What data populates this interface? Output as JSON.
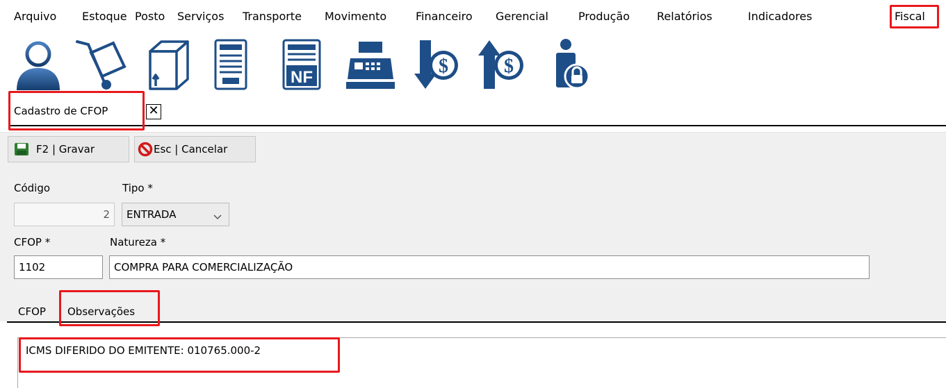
{
  "menu": {
    "items": [
      "Arquivo",
      "Estoque",
      "Posto",
      "Serviços",
      "Transporte",
      "Movimento",
      "Financeiro",
      "Gerencial",
      "Produção",
      "Relatórios",
      "Indicadores",
      "Fiscal"
    ]
  },
  "toolbar": {
    "icons": [
      "user-icon",
      "hand-truck-icon",
      "box-icon",
      "document-icon",
      "nf-invoice-icon",
      "cash-register-icon",
      "dollar-down-icon",
      "dollar-up-icon",
      "person-lock-icon"
    ],
    "nf_text": "NF"
  },
  "document_tab": {
    "label": "Cadastro de CFOP",
    "close_glyph": "✕"
  },
  "actions": {
    "save_label": "F2 | Gravar",
    "cancel_label": "Esc | Cancelar"
  },
  "form": {
    "codigo_label": "Código",
    "codigo_value": "2",
    "tipo_label": "Tipo *",
    "tipo_value": "ENTRADA",
    "cfop_label": "CFOP *",
    "cfop_value": "1102",
    "natureza_label": "Natureza *",
    "natureza_value": "COMPRA PARA COMERCIALIZAÇÃO"
  },
  "sub_tabs": {
    "tab1": "CFOP",
    "tab2": "Observações"
  },
  "observacoes": {
    "text": "ICMS DIFERIDO DO EMITENTE: 010765.000-2"
  },
  "colors": {
    "highlight": "#e8181d",
    "icon_blue": "#1e4e87"
  }
}
